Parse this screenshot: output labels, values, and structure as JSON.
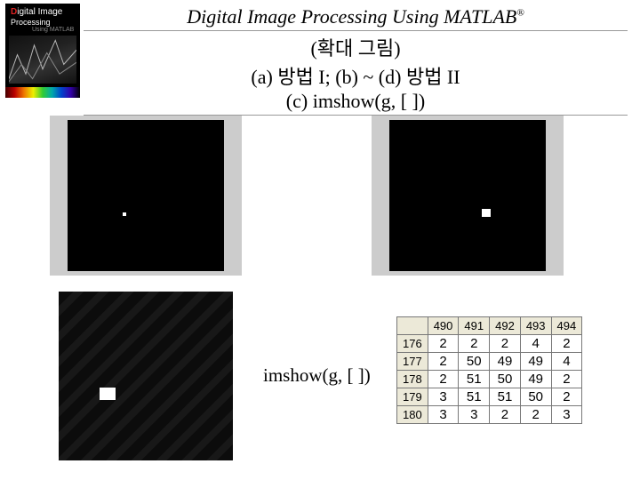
{
  "book": {
    "line1_accent": "D",
    "line1_rest": "igital Image",
    "line2": "Processing",
    "line3": "Using MATLAB"
  },
  "header": {
    "title_main": "Digital Image Processing Using MATLAB",
    "title_reg": "®",
    "subtitle1": "(확대 그림)",
    "subtitle2": "(a) 방법 I; (b) ~ (d) 방법 II",
    "subtitle3": "(c) imshow(g, [ ])"
  },
  "caption_c": "imshow(g, [ ])",
  "table": {
    "col_headers": [
      "490",
      "491",
      "492",
      "493",
      "494"
    ],
    "row_headers": [
      "176",
      "177",
      "178",
      "179",
      "180"
    ],
    "rows": [
      [
        "2",
        "2",
        "2",
        "4",
        "2"
      ],
      [
        "2",
        "50",
        "49",
        "49",
        "4"
      ],
      [
        "2",
        "51",
        "50",
        "49",
        "2"
      ],
      [
        "3",
        "51",
        "51",
        "50",
        "2"
      ],
      [
        "3",
        "3",
        "2",
        "2",
        "3"
      ]
    ]
  }
}
